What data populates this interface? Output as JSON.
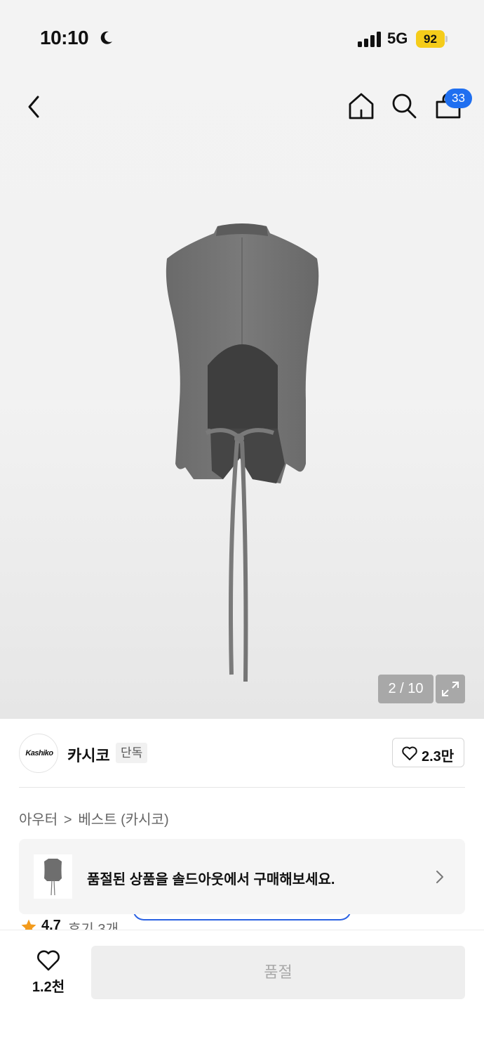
{
  "status_bar": {
    "time": "10:10",
    "network": "5G",
    "battery": "92",
    "moon_icon": "moon-icon",
    "signal_icon": "cellular-signal-icon"
  },
  "nav": {
    "back_icon": "chevron-left-icon",
    "home_icon": "home-icon",
    "search_icon": "search-icon",
    "cart_icon": "shopping-bag-icon",
    "cart_count": "33"
  },
  "gallery": {
    "counter": "2 / 10",
    "expand_icon": "expand-icon",
    "image": "product-vest-back-view"
  },
  "brand": {
    "logo_text": "Kashiko",
    "name": "카시코",
    "badge": "단독",
    "like_count": "2.3만",
    "like_icon": "heart-outline-icon"
  },
  "breadcrumb": {
    "items": [
      "아우터",
      "베스트 (카시코)"
    ],
    "separator": ">"
  },
  "soldout_banner": {
    "text": "품절된 상품을 솔드아웃에서 구매해보세요.",
    "chevron_icon": "chevron-right-icon"
  },
  "rating": {
    "score": "4.7",
    "reviews": "후기 3개",
    "star_icon": "star-icon"
  },
  "bottom_bar": {
    "wish_count": "1.2천",
    "wish_icon": "heart-outline-icon",
    "buy_label": "품절"
  },
  "colors": {
    "accent_blue": "#1f6ff0",
    "battery_yellow": "#f5cc1a",
    "star_orange": "#f39b1c"
  }
}
